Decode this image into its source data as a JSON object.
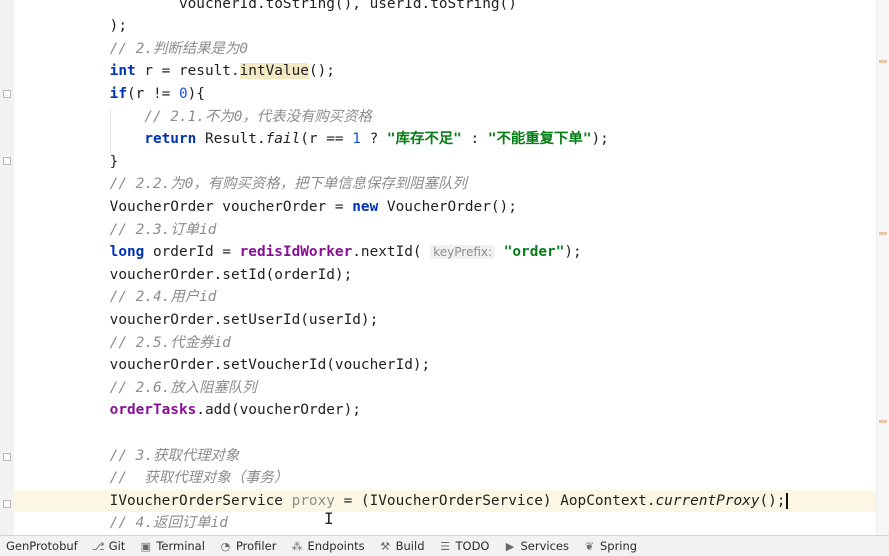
{
  "editor": {
    "lines": [
      [
        {
          "t": "            voucherId.toString(), userId.toString()",
          "c": ""
        }
      ],
      [
        {
          "t": "    );",
          "c": ""
        }
      ],
      [
        {
          "t": "    // 2.判断结果是为0",
          "c": "cm"
        }
      ],
      [
        {
          "t": "    ",
          "c": ""
        },
        {
          "t": "int",
          "c": "kw"
        },
        {
          "t": " r = result.",
          "c": ""
        },
        {
          "t": "intValue",
          "c": "hl"
        },
        {
          "t": "();",
          "c": ""
        }
      ],
      [
        {
          "t": "    ",
          "c": ""
        },
        {
          "t": "if",
          "c": "kw"
        },
        {
          "t": "(r != ",
          "c": ""
        },
        {
          "t": "0",
          "c": "num"
        },
        {
          "t": "){",
          "c": ""
        }
      ],
      [
        {
          "t": "        // 2.1.不为0，代表没有购买资格",
          "c": "cm"
        }
      ],
      [
        {
          "t": "        ",
          "c": ""
        },
        {
          "t": "return",
          "c": "kw"
        },
        {
          "t": " Result.",
          "c": ""
        },
        {
          "t": "fail",
          "c": "italic"
        },
        {
          "t": "(r == ",
          "c": ""
        },
        {
          "t": "1",
          "c": "num"
        },
        {
          "t": " ? ",
          "c": ""
        },
        {
          "t": "\"库存不足\"",
          "c": "str"
        },
        {
          "t": " : ",
          "c": ""
        },
        {
          "t": "\"不能重复下单\"",
          "c": "str"
        },
        {
          "t": ");",
          "c": ""
        }
      ],
      [
        {
          "t": "    }",
          "c": ""
        }
      ],
      [
        {
          "t": "    // 2.2.为0，有购买资格，把下单信息保存到阻塞队列",
          "c": "cm"
        }
      ],
      [
        {
          "t": "    VoucherOrder voucherOrder = ",
          "c": ""
        },
        {
          "t": "new",
          "c": "kw"
        },
        {
          "t": " VoucherOrder();",
          "c": ""
        }
      ],
      [
        {
          "t": "    // 2.3.订单id",
          "c": "cm"
        }
      ],
      [
        {
          "t": "    ",
          "c": ""
        },
        {
          "t": "long",
          "c": "kw"
        },
        {
          "t": " orderId = ",
          "c": ""
        },
        {
          "t": "redisIdWorker",
          "c": "fld"
        },
        {
          "t": ".nextId( ",
          "c": ""
        },
        {
          "t": "keyPrefix:",
          "c": "hint"
        },
        {
          "t": " ",
          "c": ""
        },
        {
          "t": "\"order\"",
          "c": "str"
        },
        {
          "t": ");",
          "c": ""
        }
      ],
      [
        {
          "t": "    voucherOrder.setId(orderId);",
          "c": ""
        }
      ],
      [
        {
          "t": "    // 2.4.用户id",
          "c": "cm"
        }
      ],
      [
        {
          "t": "    voucherOrder.setUserId(userId);",
          "c": ""
        }
      ],
      [
        {
          "t": "    // 2.5.代金券id",
          "c": "cm"
        }
      ],
      [
        {
          "t": "    voucherOrder.setVoucherId(voucherId);",
          "c": ""
        }
      ],
      [
        {
          "t": "    // 2.6.放入阻塞队列",
          "c": "cm"
        }
      ],
      [
        {
          "t": "    ",
          "c": ""
        },
        {
          "t": "orderTasks",
          "c": "fld"
        },
        {
          "t": ".add(voucherOrder);",
          "c": ""
        }
      ],
      [
        {
          "t": "",
          "c": ""
        }
      ],
      [
        {
          "t": "    // 3.获取代理对象",
          "c": "cm"
        }
      ],
      [
        {
          "t": "    //  获取代理对象（事务）",
          "c": "cm"
        }
      ],
      [
        {
          "t": "    IVoucherOrderService ",
          "c": ""
        },
        {
          "t": "proxy",
          "c": "gray"
        },
        {
          "t": " = (IVoucherOrderService) AopContext.",
          "c": ""
        },
        {
          "t": "currentProxy",
          "c": "italic"
        },
        {
          "t": "();",
          "c": ""
        }
      ],
      [
        {
          "t": "    // 4.返回订单id",
          "c": "cm"
        }
      ]
    ],
    "current_line_index": 22
  },
  "toolbar": {
    "items": [
      {
        "label": "GenProtobuf",
        "icon": "",
        "name": "gen-protobuf"
      },
      {
        "label": "Git",
        "icon": "branch-icon",
        "glyph": "⎇",
        "name": "git"
      },
      {
        "label": "Terminal",
        "icon": "terminal-icon",
        "glyph": "▣",
        "name": "terminal"
      },
      {
        "label": "Profiler",
        "icon": "profiler-icon",
        "glyph": "◔",
        "name": "profiler"
      },
      {
        "label": "Endpoints",
        "icon": "endpoints-icon",
        "glyph": "⁂",
        "name": "endpoints"
      },
      {
        "label": "Build",
        "icon": "hammer-icon",
        "glyph": "⚒",
        "name": "build"
      },
      {
        "label": "TODO",
        "icon": "list-icon",
        "glyph": "☰",
        "name": "todo"
      },
      {
        "label": "Services",
        "icon": "play-circle-icon",
        "glyph": "▶",
        "name": "services"
      },
      {
        "label": "Spring",
        "icon": "spring-leaf-icon",
        "glyph": "❦",
        "name": "spring"
      }
    ]
  }
}
